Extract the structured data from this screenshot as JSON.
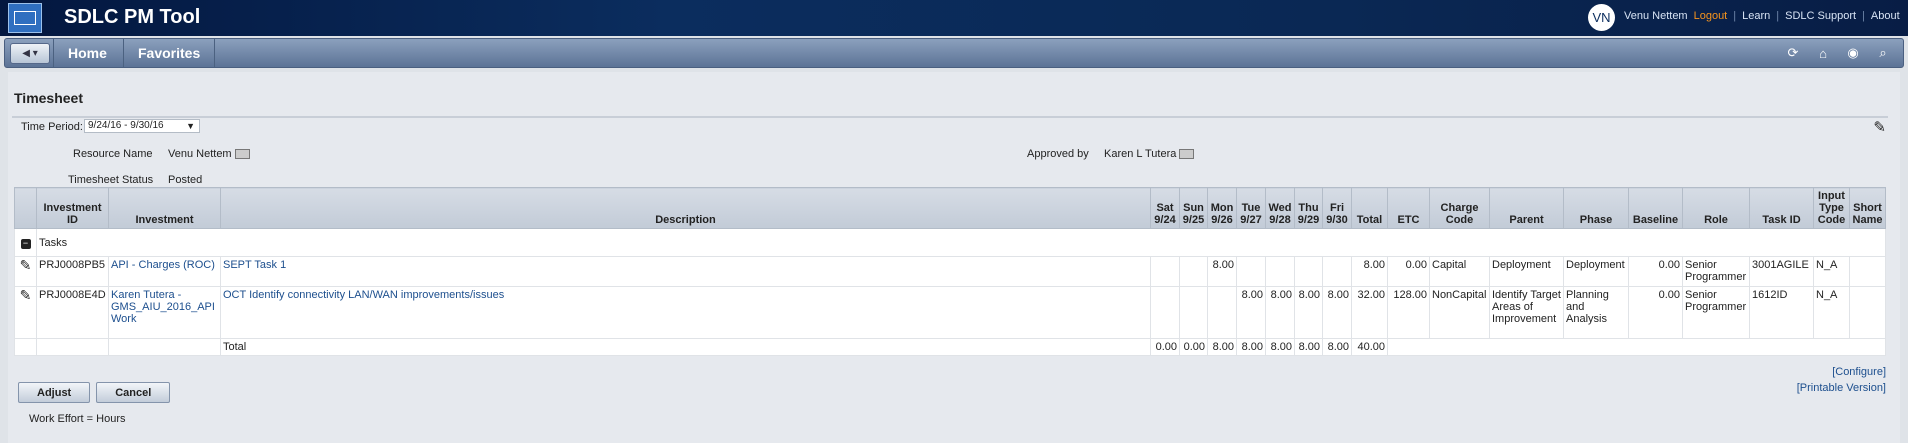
{
  "header": {
    "app_title": "SDLC PM Tool",
    "avatar_initials": "VN",
    "user_name": "Venu Nettem",
    "logout": "Logout",
    "learn": "Learn",
    "support": "SDLC Support",
    "about": "About"
  },
  "nav": {
    "home": "Home",
    "favorites": "Favorites"
  },
  "page": {
    "title": "Timesheet",
    "time_period_label": "Time Period:",
    "time_period_value": "9/24/16 - 9/30/16",
    "resource_label": "Resource Name",
    "resource_value": "Venu Nettem",
    "status_label": "Timesheet Status",
    "status_value": "Posted",
    "approved_label": "Approved by",
    "approved_value": "Karen L Tutera"
  },
  "table": {
    "headers": {
      "inv_id": "Investment ID",
      "investment": "Investment",
      "description": "Description",
      "sat": "Sat 9/24",
      "sun": "Sun 9/25",
      "mon": "Mon 9/26",
      "tue": "Tue 9/27",
      "wed": "Wed 9/28",
      "thu": "Thu 9/29",
      "fri": "Fri 9/30",
      "total": "Total",
      "etc": "ETC",
      "charge": "Charge Code",
      "parent": "Parent",
      "phase": "Phase",
      "baseline": "Baseline",
      "role": "Role",
      "task_id": "Task ID",
      "input_type": "Input Type Code",
      "short_name": "Short Name"
    },
    "group_label": "Tasks",
    "rows": [
      {
        "inv_id": "PRJ0008PB5",
        "investment": "API - Charges (ROC)",
        "description": "SEPT Task 1",
        "sat": "",
        "sun": "",
        "mon": "8.00",
        "tue": "",
        "wed": "",
        "thu": "",
        "fri": "",
        "total": "8.00",
        "etc": "0.00",
        "charge": "Capital",
        "parent": "Deployment",
        "phase": "Deployment",
        "baseline": "0.00",
        "role": "Senior Programmer",
        "task_id": "3001AGILE",
        "input_type": "N_A",
        "short_name": ""
      },
      {
        "inv_id": "PRJ0008E4D",
        "investment": "Karen Tutera - GMS_AIU_2016_API Work",
        "description": "OCT Identify connectivity LAN/WAN improvements/issues",
        "sat": "",
        "sun": "",
        "mon": "",
        "tue": "8.00",
        "wed": "8.00",
        "thu": "8.00",
        "fri": "8.00",
        "total": "32.00",
        "etc": "128.00",
        "charge": "NonCapital",
        "parent": "Identify Target Areas of Improvement",
        "phase": "Planning and Analysis",
        "baseline": "0.00",
        "role": "Senior Programmer",
        "task_id": "1612ID",
        "input_type": "N_A",
        "short_name": ""
      }
    ],
    "totals": {
      "label": "Total",
      "sat": "0.00",
      "sun": "0.00",
      "mon": "8.00",
      "tue": "8.00",
      "wed": "8.00",
      "thu": "8.00",
      "fri": "8.00",
      "total": "40.00"
    }
  },
  "actions": {
    "adjust": "Adjust",
    "cancel": "Cancel",
    "configure": "[Configure]",
    "printable": "[Printable Version]"
  },
  "footer": {
    "work_effort": "Work Effort = Hours"
  }
}
